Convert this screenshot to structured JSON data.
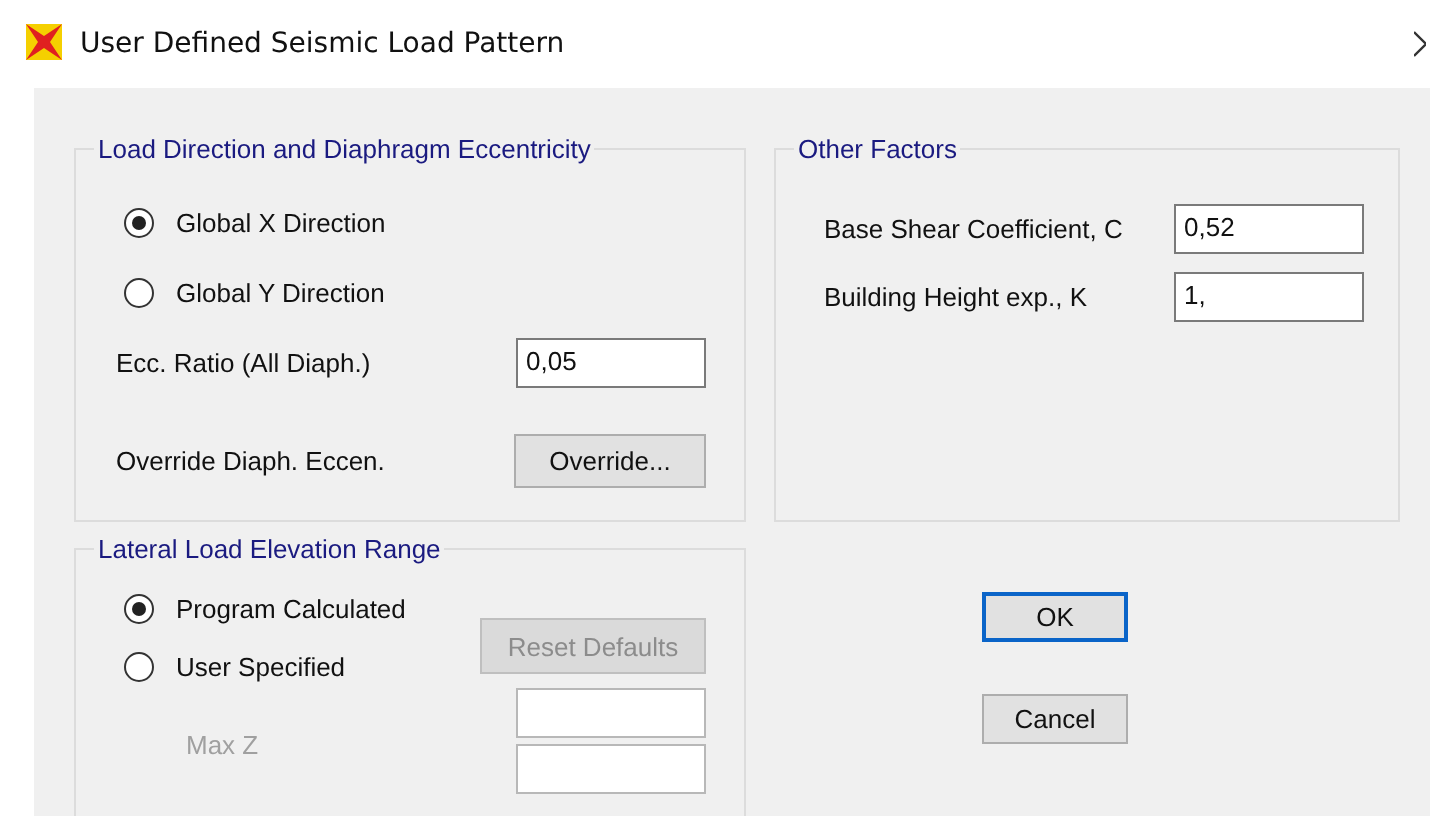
{
  "window": {
    "title": "User Defined Seismic Load Pattern"
  },
  "load_direction": {
    "title": "Load Direction and Diaphragm Eccentricity",
    "options": [
      {
        "label": "Global  X  Direction",
        "selected": true
      },
      {
        "label": "Global  Y  Direction",
        "selected": false
      }
    ],
    "ecc_ratio": {
      "label": "Ecc. Ratio (All Diaph.)",
      "value": "0,05"
    },
    "override": {
      "label": "Override Diaph. Eccen.",
      "button": "Override..."
    }
  },
  "other_factors": {
    "title": "Other Factors",
    "fields": [
      {
        "label": "Base Shear Coefficient, C",
        "value": "0,52"
      },
      {
        "label": "Building Height exp., K",
        "value": "1,"
      }
    ]
  },
  "elevation_range": {
    "title": "Lateral Load Elevation Range",
    "options": [
      {
        "label": "Program Calculated",
        "selected": true
      },
      {
        "label": "User Specified",
        "selected": false
      }
    ],
    "reset_button": {
      "label": "Reset Defaults",
      "disabled": true
    },
    "max_z": {
      "label": "Max Z",
      "disabled": true
    }
  },
  "buttons": [
    {
      "label": "OK",
      "default": true
    },
    {
      "label": "Cancel",
      "default": false
    }
  ]
}
